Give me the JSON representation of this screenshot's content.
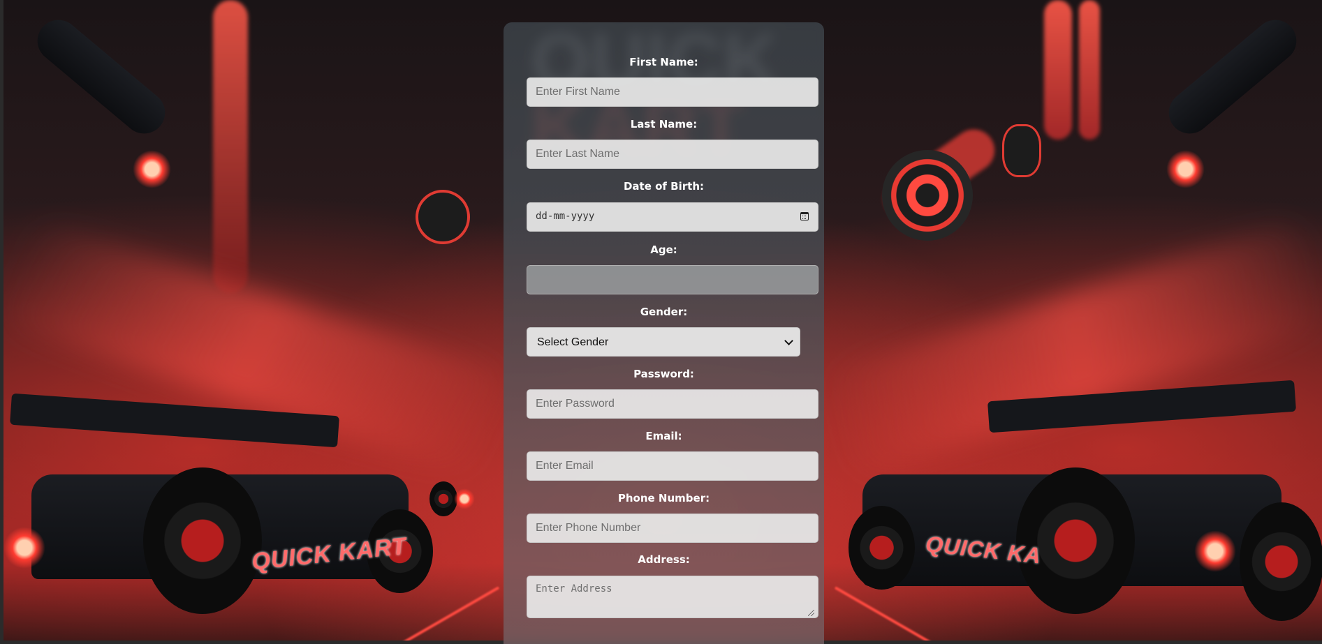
{
  "background": {
    "brand_text": "QUICK KART"
  },
  "form": {
    "first_name": {
      "label": "First Name:",
      "placeholder": "Enter First Name"
    },
    "last_name": {
      "label": "Last Name:",
      "placeholder": "Enter Last Name"
    },
    "dob": {
      "label": "Date of Birth:",
      "placeholder": "dd-mm-yyyy"
    },
    "age": {
      "label": "Age:",
      "placeholder": ""
    },
    "gender": {
      "label": "Gender:",
      "selected": "Select Gender"
    },
    "password": {
      "label": "Password:",
      "placeholder": "Enter Password"
    },
    "email": {
      "label": "Email:",
      "placeholder": "Enter Email"
    },
    "phone": {
      "label": "Phone Number:",
      "placeholder": "Enter Phone Number"
    },
    "address": {
      "label": "Address:",
      "placeholder": "Enter Address"
    }
  },
  "colors": {
    "accent_red": "#ff4a40",
    "card_bg": "#3c4248",
    "label_text": "#ffffff"
  }
}
